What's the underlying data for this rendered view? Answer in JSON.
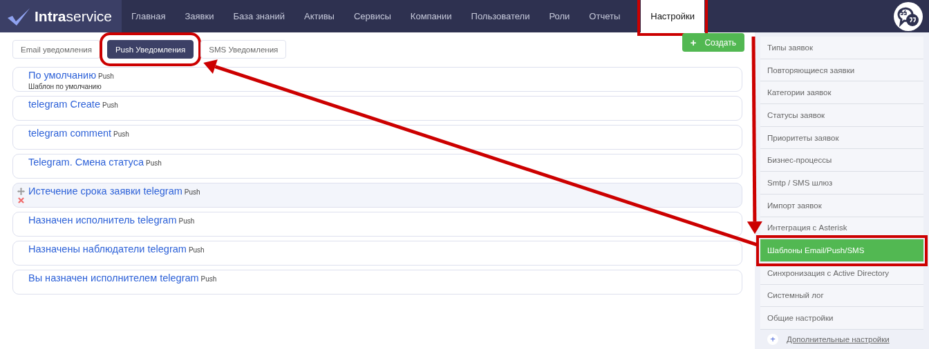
{
  "header": {
    "logo": "**Intra**service",
    "nav_items": [
      {
        "label": "Главная",
        "selected": false,
        "highlighted": false
      },
      {
        "label": "Заявки",
        "selected": false,
        "highlighted": false
      },
      {
        "label": "База знаний",
        "selected": false,
        "highlighted": false
      },
      {
        "label": "Активы",
        "selected": false,
        "highlighted": false
      },
      {
        "label": "Сервисы",
        "selected": false,
        "highlighted": false
      },
      {
        "label": "Компании",
        "selected": false,
        "highlighted": false
      },
      {
        "label": "Пользователи",
        "selected": false,
        "highlighted": false
      },
      {
        "label": "Роли",
        "selected": false,
        "highlighted": false
      },
      {
        "label": "Отчеты",
        "selected": false,
        "highlighted": false
      },
      {
        "label": "Настройки",
        "selected": true,
        "highlighted": true
      }
    ]
  },
  "tabs": [
    {
      "label": "Email уведомления",
      "selected": false,
      "highlighted": false
    },
    {
      "label": "Push Уведомления",
      "selected": true,
      "highlighted": true
    },
    {
      "label": "SMS Уведомления",
      "selected": false,
      "highlighted": false
    }
  ],
  "create_button": {
    "icon": "+",
    "label": "Создать"
  },
  "templates": [
    {
      "title": "По умолчанию",
      "type": "Push",
      "description": "Шаблон по умолчанию",
      "hovered": false
    },
    {
      "title": "telegram Create",
      "type": "Push",
      "hovered": false
    },
    {
      "title": "telegram comment",
      "type": "Push",
      "hovered": false
    },
    {
      "title": "Telegram. Смена статуса",
      "type": "Push",
      "hovered": false
    },
    {
      "title": "Истечение срока заявки telegram",
      "type": "Push",
      "hovered": true
    },
    {
      "title": "Назначен исполнитель telegram",
      "type": "Push",
      "hovered": false
    },
    {
      "title": "Назначены наблюдатели telegram",
      "type": "Push",
      "hovered": false
    },
    {
      "title": "Вы назначен исполнителем telegram",
      "type": "Push",
      "hovered": false
    }
  ],
  "sidebar": {
    "items": [
      {
        "label": "Типы заявок",
        "selected": false,
        "highlighted": false
      },
      {
        "label": "Повторяющиеся заявки",
        "selected": false,
        "highlighted": false
      },
      {
        "label": "Категории заявок",
        "selected": false,
        "highlighted": false
      },
      {
        "label": "Статусы заявок",
        "selected": false,
        "highlighted": false
      },
      {
        "label": "Приоритеты заявок",
        "selected": false,
        "highlighted": false
      },
      {
        "label": "Бизнес-процессы",
        "selected": false,
        "highlighted": false
      },
      {
        "label": "Smtp / SMS шлюз",
        "selected": false,
        "highlighted": false
      },
      {
        "label": "Импорт заявок",
        "selected": false,
        "highlighted": false
      },
      {
        "label": "Интеграция с Asterisk",
        "selected": false,
        "highlighted": false
      },
      {
        "label": "Шаблоны Email/Push/SMS",
        "selected": true,
        "highlighted": true
      },
      {
        "label": "Синхронизация с Active Directory",
        "selected": false,
        "highlighted": false
      },
      {
        "label": "Системный лог",
        "selected": false,
        "highlighted": false
      },
      {
        "label": "Общие настройки",
        "selected": false,
        "highlighted": false
      }
    ],
    "more": {
      "icon": "+",
      "label": "Дополнительные настройки"
    }
  }
}
